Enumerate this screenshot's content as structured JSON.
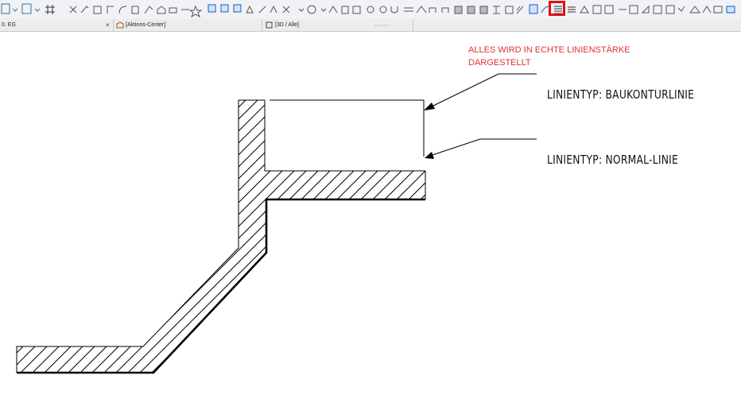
{
  "toolbar": {
    "icons": [
      "arrow-dropdown",
      "grid-dropdown",
      "hash-grid",
      "scissors",
      "magic-wand",
      "wall",
      "beam",
      "slab",
      "roof",
      "column",
      "stair",
      "railing",
      "window",
      "door",
      "object",
      "zone",
      "mesh",
      "fill",
      "line",
      "arc",
      "polyline",
      "text",
      "label",
      "dimension",
      "level",
      "camera",
      "section",
      "elevation",
      "detail",
      "worksheet",
      "figure",
      "hatch-highlighted",
      "markup"
    ],
    "highlight_label": "Hatch tool"
  },
  "tabs": [
    {
      "label": "0. EG",
      "close": "×"
    },
    {
      "label": "[Aktions-Center]"
    },
    {
      "label": "[3D / Alle]"
    }
  ],
  "note": {
    "line1": "ALLES WIRD IN ECHTE  LINIENSTÄRKE",
    "line2": "DARGESTELLT"
  },
  "labels": {
    "baukontur": "LINIENTYP: BAUKONTURLINIE",
    "normal": "LINIENTYP: NORMAL-LINIE"
  },
  "colors": {
    "highlight": "#e3101b",
    "note": "#e03030",
    "lines": "#000000"
  }
}
